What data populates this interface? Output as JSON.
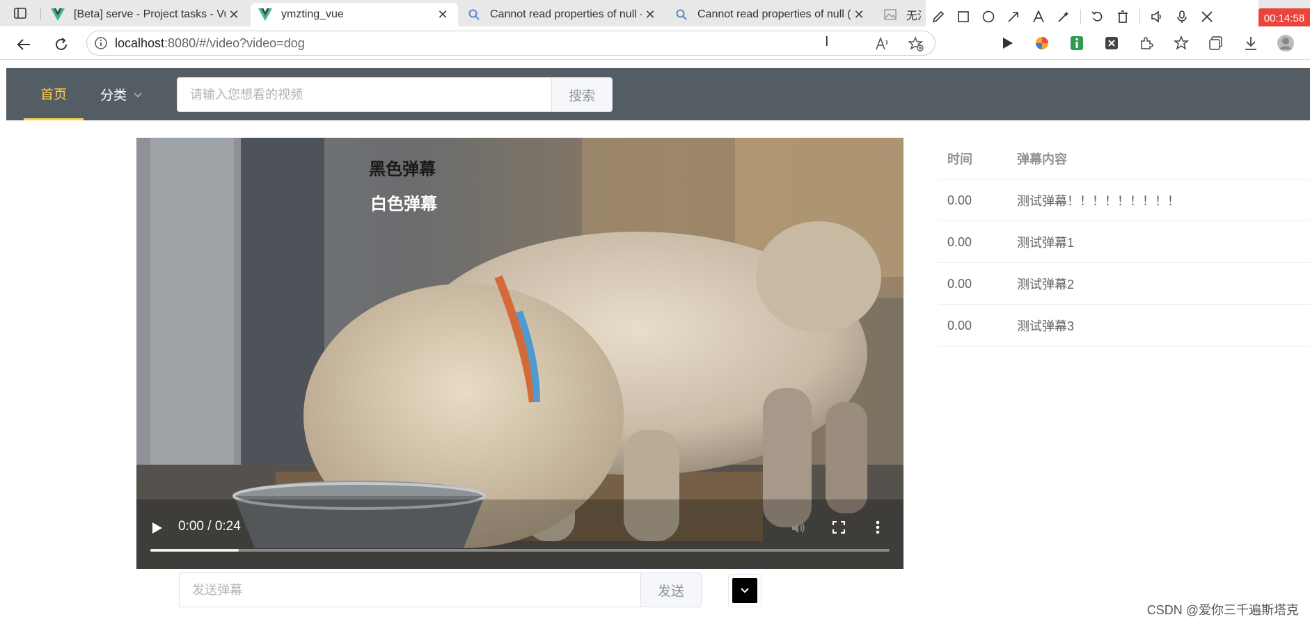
{
  "browser": {
    "tabs": [
      {
        "title": "[Beta] serve - Project tasks - Vue",
        "icon": "vue-icon"
      },
      {
        "title": "ymzting_vue",
        "icon": "vue-icon",
        "active": true
      },
      {
        "title": "Cannot read properties of null - f",
        "icon": "search-icon"
      },
      {
        "title": "Cannot read properties of null (re",
        "icon": "search-icon"
      },
      {
        "title": "无法",
        "icon": "image-icon"
      }
    ],
    "url_host": "localhost",
    "url_rest": ":8080/#/video?video=dog",
    "record_timer": "00:14:58"
  },
  "header": {
    "menu": [
      {
        "label": "首页",
        "active": true
      },
      {
        "label": "分类"
      }
    ],
    "search_placeholder": "请输入您想看的视频",
    "search_button": "搜索",
    "colors": {
      "bg": "#545c64",
      "active": "#ffd04b"
    }
  },
  "video": {
    "danmaku": [
      {
        "text": "黑色弹幕",
        "color": "#1a1a1a"
      },
      {
        "text": "白色弹幕",
        "color": "#ffffff"
      }
    ],
    "time": "0:00 / 0:24",
    "buffered": 0.12
  },
  "send": {
    "placeholder": "发送弹幕",
    "button": "发送",
    "color": "#000000"
  },
  "table": {
    "headers": [
      "时间",
      "弹幕内容"
    ],
    "rows": [
      [
        "0.00",
        "测试弹幕！！！！！！！！！"
      ],
      [
        "0.00",
        "测试弹幕1"
      ],
      [
        "0.00",
        "测试弹幕2"
      ],
      [
        "0.00",
        "测试弹幕3"
      ]
    ]
  },
  "watermark": "CSDN @爱你三千遍斯塔克"
}
